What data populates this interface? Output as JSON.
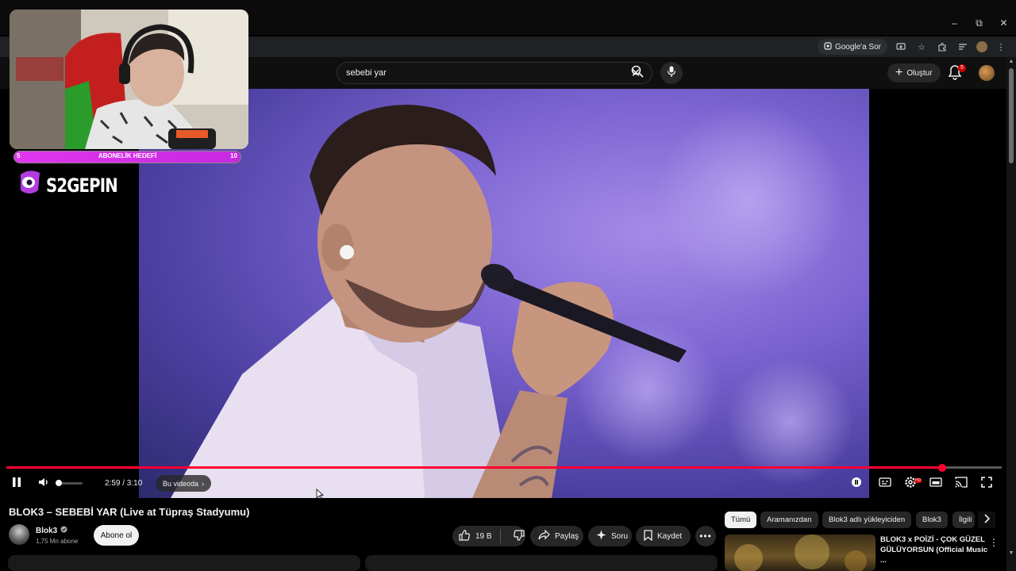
{
  "browser": {
    "google_lens_label": "Google'a Sor",
    "window_controls": {
      "minimize": "–",
      "restore": "⧉",
      "close": "✕"
    }
  },
  "header": {
    "search": {
      "value": "sebebi yar"
    },
    "create_label": "Oluştur",
    "notification_count": "5"
  },
  "overlay": {
    "sub_goal": {
      "min": "5",
      "label": "ABONELİK HEDEFİ",
      "max": "10"
    },
    "streamer_name": "S2GEPIN"
  },
  "player": {
    "progress_fraction": 0.94,
    "current_time": "2:59",
    "duration": "3:10",
    "time_display": "2:59 / 3:10",
    "chapter_chip": "Bu videoda",
    "hd_badge": "HD"
  },
  "video": {
    "title": "BLOK3 – SEBEBİ YAR (Live at Tüpraş Stadyumu)",
    "channel_name": "Blok3",
    "subscribers": "1,75 Mn abone",
    "subscribe_label": "Abone ol",
    "like_count": "19 B",
    "share_label": "Paylaş",
    "ask_label": "Soru",
    "save_label": "Kaydet"
  },
  "filters": {
    "chips": [
      "Tümü",
      "Aramanızdan",
      "Blok3 adlı yükleyiciden",
      "Blok3",
      "İlgili"
    ]
  },
  "recommendation": {
    "title": "BLOK3 x POİZİ - ÇOK GÜZEL GÜLÜYORSUN (Official Music ..."
  },
  "colors": {
    "accent_red": "#ff0033",
    "sub_goal_bar": "#e036ef",
    "background": "#0f0f0f"
  }
}
